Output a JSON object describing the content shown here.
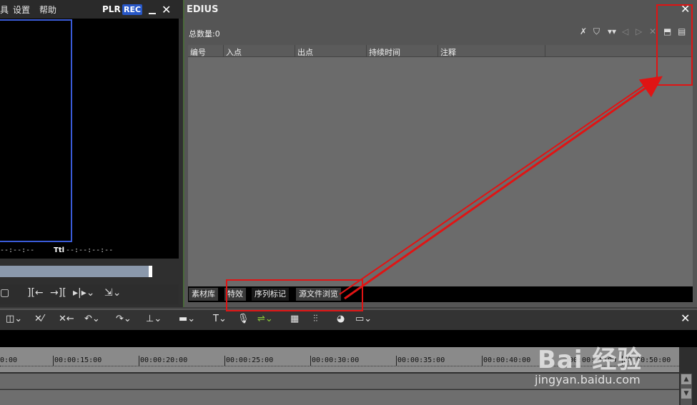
{
  "left_player": {
    "menu": [
      "具",
      "设置",
      "帮助"
    ],
    "plr": "PLR",
    "rec": "REC",
    "close": "✕",
    "timecode_left": "--:--:--",
    "tl_label": "Ttl",
    "timecode_right": "--:--:--:--"
  },
  "edius_panel": {
    "title": "EDIUS",
    "close": "✕",
    "total_count": "总数量:0",
    "columns": [
      "编号",
      "入点",
      "出点",
      "持续时间",
      "注释"
    ],
    "tabs": [
      "素材库",
      "特效",
      "序列标记",
      "源文件浏览"
    ]
  },
  "timeline": {
    "close": "✕",
    "ruler_labels": [
      "0:00",
      "00:00:15:00",
      "00:00:20:00",
      "00:00:25:00",
      "00:00:30:00",
      "00:00:35:00",
      "00:00:40:00",
      "00:00:45:00",
      "00:00:50:00"
    ]
  },
  "watermark": {
    "logo": "Bai 经验",
    "url": "jingyan.baidu.com"
  },
  "colors": {
    "annotation_red": "#e01414",
    "rec_blue": "#2858c8",
    "safe_frame_blue": "#3a5bd8"
  }
}
